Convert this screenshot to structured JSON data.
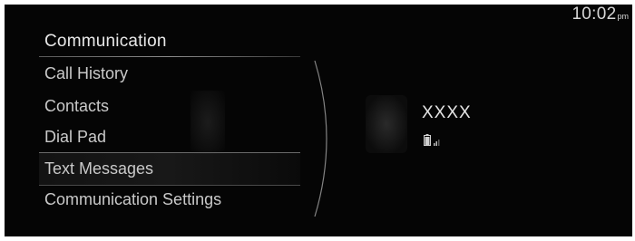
{
  "status_bar": {
    "time": "10:02",
    "ampm": "pm"
  },
  "menu": {
    "title": "Communication",
    "items": [
      {
        "label": "Call History",
        "selected": false
      },
      {
        "label": "Contacts",
        "selected": false
      },
      {
        "label": "Dial Pad",
        "selected": false
      },
      {
        "label": "Text Messages",
        "selected": true
      },
      {
        "label": "Communication Settings",
        "selected": false
      }
    ]
  },
  "device": {
    "name": "XXXX",
    "icons": [
      "battery-icon",
      "signal-strength-icon"
    ]
  },
  "colors": {
    "screen_background": "#050505",
    "text_primary": "#e8e8e8",
    "text_secondary": "#c9c9c9"
  }
}
